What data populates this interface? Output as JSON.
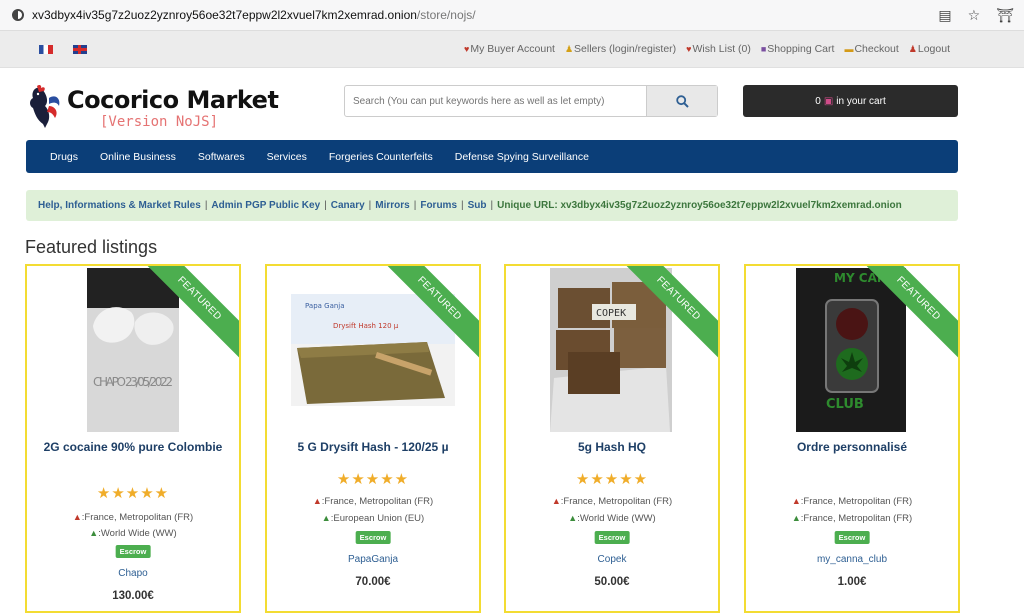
{
  "browser": {
    "host": "xv3dbyx4iv35g7z2uoz2yznroy56oe32t7eppw2l2xvuel7km2xemrad.onion",
    "path": "/store/nojs/"
  },
  "topbar": {
    "links": [
      {
        "icon": "user-icon",
        "label": "My Buyer Account"
      },
      {
        "icon": "seller-icon",
        "label": "Sellers (login/register)"
      },
      {
        "icon": "heart-icon",
        "label": "Wish List (0)"
      },
      {
        "icon": "cart-icon",
        "label": "Shopping Cart"
      },
      {
        "icon": "card-icon",
        "label": "Checkout"
      },
      {
        "icon": "logout-icon",
        "label": "Logout"
      }
    ]
  },
  "logo": {
    "name": "Cocorico Market",
    "version": "[Version NoJS]"
  },
  "search": {
    "placeholder": "Search (You can put keywords here as well as let empty)"
  },
  "cart": {
    "count": "0",
    "label": "in your cart"
  },
  "nav": {
    "items": [
      "Drugs",
      "Online Business",
      "Softwares",
      "Services",
      "Forgeries Counterfeits",
      "Defense Spying Surveillance"
    ]
  },
  "infobar": {
    "links": [
      "Help, Informations & Market Rules",
      "Admin PGP Public Key",
      "Canary",
      "Mirrors",
      "Forums",
      "Sub"
    ],
    "unique": "Unique URL: xv3dbyx4iv35g7z2uoz2yznroy56oe32t7eppw2l2xvuel7km2xemrad.onion"
  },
  "featured": {
    "title": "Featured listings",
    "ribbon": "FEATURED",
    "listings": [
      {
        "title": "2G cocaine 90% pure Colombie",
        "rating": 5,
        "from": "France, Metropolitan (FR)",
        "to": "World Wide (WW)",
        "escrow": "Escrow",
        "seller": "Chapo",
        "price": "130.00€"
      },
      {
        "title": "5 G Drysift Hash - 120/25 µ",
        "rating": 5,
        "from": "France, Metropolitan (FR)",
        "to": "European Union (EU)",
        "escrow": "Escrow",
        "seller": "PapaGanja",
        "price": "70.00€"
      },
      {
        "title": "5g Hash HQ",
        "rating": 5,
        "from": "France, Metropolitan (FR)",
        "to": "World Wide (WW)",
        "escrow": "Escrow",
        "seller": "Copek",
        "price": "50.00€"
      },
      {
        "title": "Ordre personnalisé",
        "rating": 0,
        "from": "France, Metropolitan (FR)",
        "to": "France, Metropolitan (FR)",
        "escrow": "Escrow",
        "seller": "my_canna_club",
        "price": "1.00€"
      }
    ],
    "image_texts": {
      "chapo_note": "CHAPO 23/05/2022",
      "papa_label": "Papa Ganja",
      "drysift_label": "Drysift Hash 120 µ",
      "copek_label": "COPEK",
      "canna_top": "MY CANNA",
      "canna_bottom": "CLUB"
    }
  }
}
